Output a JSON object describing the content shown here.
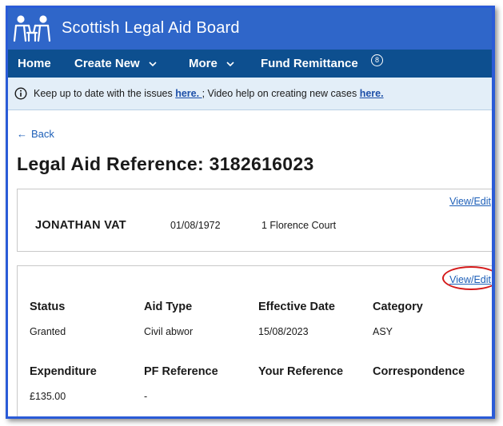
{
  "header": {
    "title": "Scottish Legal Aid Board",
    "logo_icon": "slab-logo-icon",
    "brand_color": "#2f66c9",
    "nav_color": "#0d4f8f"
  },
  "nav": {
    "items": [
      {
        "label": "Home",
        "has_dropdown": false
      },
      {
        "label": "Create New",
        "has_dropdown": true
      },
      {
        "label": "More",
        "has_dropdown": true
      },
      {
        "label": "Fund Remittance",
        "has_dropdown": false,
        "badge": "8"
      }
    ]
  },
  "info_banner": {
    "text_1": "Keep up to date with the issues ",
    "link_1": "here. ",
    "text_2": "; Video help on creating new cases ",
    "link_2": "here.",
    "icon": "info-icon"
  },
  "back": {
    "label": "Back",
    "icon": "arrow-left-icon"
  },
  "page_title": "Legal Aid Reference: 3182616023",
  "client_card": {
    "view_edit": "View/Edit",
    "name": "JONATHAN VAT",
    "dob": "01/08/1972",
    "address": "1 Florence Court"
  },
  "details_card": {
    "view_edit": "View/Edit",
    "highlight_color": "#d41919",
    "fields": [
      {
        "label": "Status",
        "value": "Granted"
      },
      {
        "label": "Aid Type",
        "value": "Civil abwor"
      },
      {
        "label": "Effective Date",
        "value": "15/08/2023"
      },
      {
        "label": "Category",
        "value": "ASY"
      },
      {
        "label": "Expenditure",
        "value": "£135.00"
      },
      {
        "label": "PF Reference",
        "value": "-"
      },
      {
        "label": "Your Reference",
        "value": ""
      },
      {
        "label": "Correspondence",
        "value": ""
      }
    ]
  }
}
